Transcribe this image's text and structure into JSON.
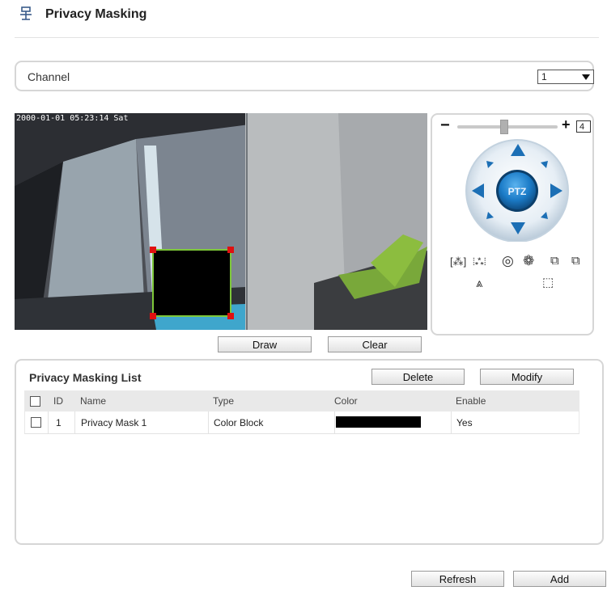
{
  "header": {
    "title": "Privacy Masking",
    "icon": "privacy-camera-icon"
  },
  "channel": {
    "label": "Channel",
    "selected": "1"
  },
  "video": {
    "timestamp": "2000-01-01 05:23:14 Sat"
  },
  "ptz": {
    "zoom_value": "4",
    "center_label": "PTZ",
    "accent_color": "#1c6fb5"
  },
  "actions": {
    "draw": "Draw",
    "clear": "Clear"
  },
  "list": {
    "title": "Privacy Masking List",
    "delete": "Delete",
    "modify": "Modify",
    "columns": {
      "id": "ID",
      "name": "Name",
      "type": "Type",
      "color": "Color",
      "enable": "Enable"
    },
    "rows": [
      {
        "id": "1",
        "name": "Privacy Mask 1",
        "type": "Color Block",
        "color": "#000000",
        "enable": "Yes"
      }
    ]
  },
  "footer": {
    "refresh": "Refresh",
    "add": "Add"
  }
}
